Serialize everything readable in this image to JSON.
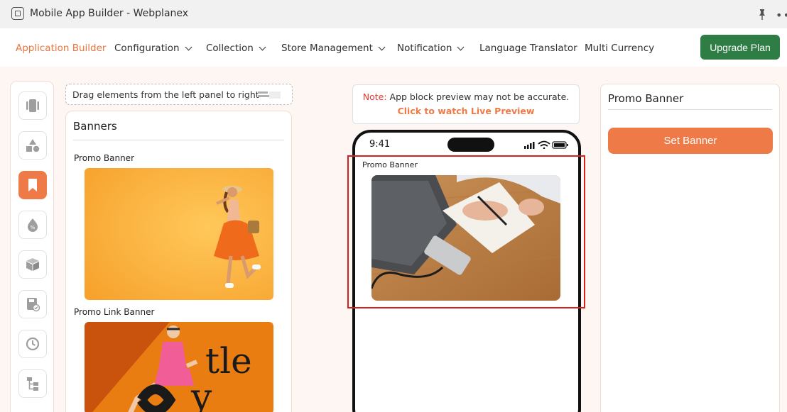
{
  "window": {
    "title": "Mobile App Builder - Webplanex",
    "icons": [
      "app-icon",
      "pin-icon",
      "more-icon"
    ]
  },
  "nav": {
    "items": [
      {
        "label": "Application Builder",
        "active": true,
        "dropdown": false
      },
      {
        "label": "Configuration",
        "active": false,
        "dropdown": true
      },
      {
        "label": "Collection",
        "active": false,
        "dropdown": true
      },
      {
        "label": "Store Management",
        "active": false,
        "dropdown": true
      },
      {
        "label": "Notification",
        "active": false,
        "dropdown": true
      },
      {
        "label": "Language Translator",
        "active": false,
        "dropdown": false
      },
      {
        "label": "Multi Currency",
        "active": false,
        "dropdown": false
      }
    ],
    "upgrade_label": "Upgrade Plan"
  },
  "rail": {
    "icons": [
      "phone-layout-icon",
      "shapes-icon",
      "bookmark-icon",
      "discount-icon",
      "box-icon",
      "save-check-icon",
      "history-icon",
      "hierarchy-icon"
    ],
    "active": "bookmark-icon"
  },
  "drag_hint": "Drag elements from the left panel to right",
  "banners": {
    "title": "Banners",
    "items": [
      {
        "label": "Promo Banner"
      },
      {
        "label": "Promo Link Banner"
      }
    ]
  },
  "preview": {
    "note_label": "Note:",
    "note_text": " App block preview may not be accurate.",
    "live_link": "Click to watch Live Preview",
    "time": "9:41",
    "block_label": "Promo Banner"
  },
  "settings": {
    "title": "Promo Banner",
    "set_banner_label": "Set Banner"
  },
  "colors": {
    "accent": "#ee7b47",
    "active_nav": "#e8743f",
    "upgrade": "#2e7d45",
    "highlight": "#d61f1f"
  }
}
